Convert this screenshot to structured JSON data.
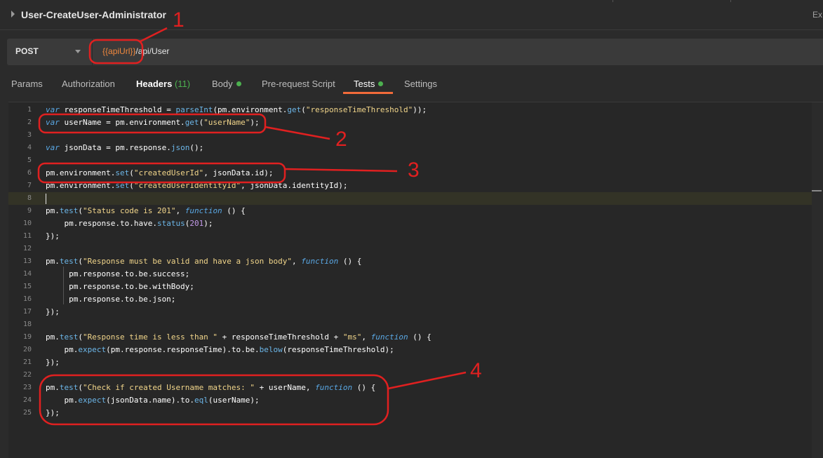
{
  "titlebar": {
    "title": "User-CreateUser-Administrator",
    "right_text": "Ex"
  },
  "request": {
    "method": "POST",
    "url_variable": "{{apiUrl}}",
    "url_path": "/api/User"
  },
  "tabs": [
    {
      "label": "Params"
    },
    {
      "label": "Authorization"
    },
    {
      "label": "Headers",
      "count": "(11)"
    },
    {
      "label": "Body",
      "dot": true
    },
    {
      "label": "Pre-request Script"
    },
    {
      "label": "Tests",
      "dot": true,
      "active": true
    },
    {
      "label": "Settings"
    }
  ],
  "code_lines": [
    "var responseTimeThreshold = parseInt(pm.environment.get(\"responseTimeThreshold\"));",
    "var userName = pm.environment.get(\"userName\");",
    "",
    "var jsonData = pm.response.json();",
    "",
    "pm.environment.set(\"createdUserId\", jsonData.id);",
    "pm.environment.set(\"createdUserIdentityId\", jsonData.identityId);",
    "",
    "pm.test(\"Status code is 201\", function () {",
    "    pm.response.to.have.status(201);",
    "});",
    "",
    "pm.test(\"Response must be valid and have a json body\", function () {",
    "     pm.response.to.be.success;",
    "     pm.response.to.be.withBody;",
    "     pm.response.to.be.json;",
    "});",
    "",
    "pm.test(\"Response time is less than \" + responseTimeThreshold + \"ms\", function () {",
    "    pm.expect(pm.response.responseTime).to.be.below(responseTimeThreshold);",
    "});",
    "",
    "pm.test(\"Check if created Username matches: \" + userName, function () {",
    "    pm.expect(jsonData.name).to.eql(userName);",
    "});"
  ],
  "current_line": 8,
  "annotations": [
    "1",
    "2",
    "3",
    "4"
  ],
  "colors": {
    "annotation": "#e02020",
    "accent_tab": "#f26b3a",
    "status_green": "#4cb04f",
    "url_variable": "#f0883e"
  }
}
